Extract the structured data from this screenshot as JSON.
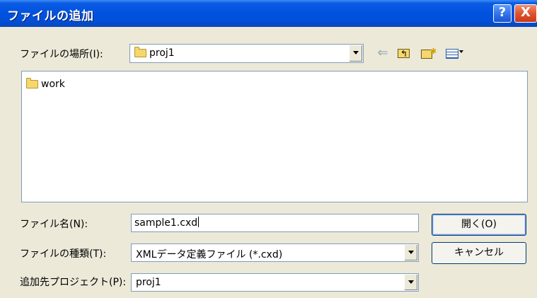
{
  "window": {
    "title": "ファイルの追加",
    "help_label": "?",
    "close_label": "X"
  },
  "lookin": {
    "label": "ファイルの場所(I):",
    "value": "proj1"
  },
  "toolbar": {
    "icons": [
      "back-icon",
      "up-folder-icon",
      "new-folder-icon",
      "view-menu-icon"
    ]
  },
  "file_list": {
    "items": [
      {
        "name": "work",
        "icon": "folder-icon"
      }
    ]
  },
  "filename": {
    "label": "ファイル名(N):",
    "value": "sample1.cxd"
  },
  "filetype": {
    "label": "ファイルの種類(T):",
    "value": "XMLデータ定義ファイル (*.cxd)"
  },
  "project": {
    "label": "追加先プロジェクト(P):",
    "value": "proj1"
  },
  "buttons": {
    "open_label": "開く(O)",
    "cancel_label": "キャンセル"
  },
  "colors": {
    "title_bar": "#0052df",
    "dialog_bg": "#ece9d8",
    "close_button": "#e0542c"
  }
}
